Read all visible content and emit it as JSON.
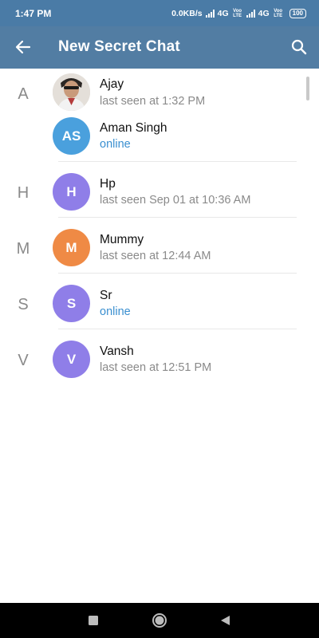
{
  "status_bar": {
    "time": "1:47 PM",
    "speed": "0.0KB/s",
    "net1": "4G",
    "volte1": "Voo LTE",
    "net2": "4G",
    "volte2": "Voo LTE",
    "battery": "100"
  },
  "header": {
    "title": "New Secret Chat",
    "back_icon": "arrow-left-icon",
    "search_icon": "search-icon"
  },
  "contacts": [
    {
      "letter": "A",
      "name": "Ajay",
      "status": "last seen at 1:32 PM",
      "online": false,
      "initials": "",
      "photo": true
    },
    {
      "letter": "",
      "name": "Aman Singh",
      "status": "online",
      "online": true,
      "initials": "AS",
      "color": "#4aa0dd"
    },
    {
      "letter": "H",
      "name": "Hp",
      "status": "last seen Sep 01 at 10:36 AM",
      "online": false,
      "initials": "H",
      "color": "#8f7ee8"
    },
    {
      "letter": "M",
      "name": "Mummy",
      "status": "last seen at 12:44 AM",
      "online": false,
      "initials": "M",
      "color": "#ef8a45"
    },
    {
      "letter": "S",
      "name": "Sr",
      "status": "online",
      "online": true,
      "initials": "S",
      "color": "#8f7ee8"
    },
    {
      "letter": "V",
      "name": "Vansh",
      "status": "last seen at 12:51 PM",
      "online": false,
      "initials": "V",
      "color": "#8f7ee8"
    }
  ],
  "nav": {
    "recents_icon": "square-icon",
    "home_icon": "circle-icon",
    "back_icon": "triangle-back-icon"
  }
}
